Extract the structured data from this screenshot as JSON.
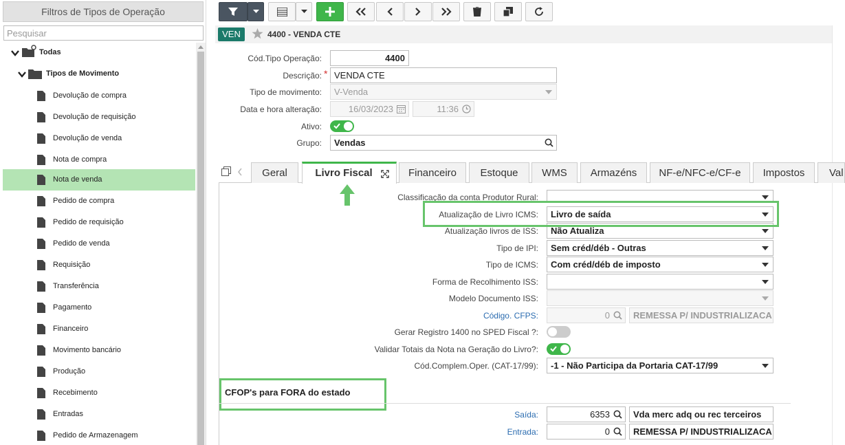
{
  "sidebar": {
    "title": "Filtros de Tipos de Operação",
    "search_placeholder": "Pesquisar",
    "tree": [
      {
        "label": "Todas",
        "level": 0
      },
      {
        "label": "Tipos de Movimento",
        "level": 1
      },
      {
        "label": "Devolução de compra",
        "level": 2
      },
      {
        "label": "Devolução de requisição",
        "level": 2
      },
      {
        "label": "Devolução de venda",
        "level": 2
      },
      {
        "label": "Nota de compra",
        "level": 2
      },
      {
        "label": "Nota de venda",
        "level": 2,
        "selected": true
      },
      {
        "label": "Pedido de compra",
        "level": 2
      },
      {
        "label": "Pedido de requisição",
        "level": 2
      },
      {
        "label": "Pedido de venda",
        "level": 2
      },
      {
        "label": "Requisição",
        "level": 2
      },
      {
        "label": "Transferência",
        "level": 2
      },
      {
        "label": "Pagamento",
        "level": 2
      },
      {
        "label": "Financeiro",
        "level": 2
      },
      {
        "label": "Movimento bancário",
        "level": 2
      },
      {
        "label": "Produção",
        "level": 2
      },
      {
        "label": "Recebimento",
        "level": 2
      },
      {
        "label": "Entradas",
        "level": 2
      },
      {
        "label": "Pedido de Armazenagem",
        "level": 2
      }
    ]
  },
  "toolbar": {
    "buttons": [
      "filter-icon",
      "dropdown-caret-icon",
      "list-icon",
      "dropdown-caret-icon",
      "plus-icon",
      "first-icon",
      "prev-icon",
      "next-icon",
      "last-icon",
      "trash-icon",
      "copy-icon",
      "refresh-icon"
    ]
  },
  "record": {
    "badge": "VEN",
    "title": "4400 - VENDA CTE"
  },
  "form": {
    "cod_label": "Cód.Tipo Operação:",
    "cod_value": "4400",
    "desc_label": "Descrição:",
    "desc_value": "VENDA CTE",
    "tipo_mov_label": "Tipo de movimento:",
    "tipo_mov_value": "V-Venda",
    "data_label": "Data e hora alteração:",
    "data_value": "16/03/2023",
    "hora_value": "11:36",
    "ativo_label": "Ativo:",
    "ativo_on": true,
    "grupo_label": "Grupo:",
    "grupo_value": "Vendas"
  },
  "tabs": [
    "Geral",
    "Livro Fiscal",
    "Financeiro",
    "Estoque",
    "WMS",
    "Armazéns",
    "NF-e/NFC-e/CF-e",
    "Impostos",
    "Val"
  ],
  "active_tab": "Livro Fiscal",
  "livro": {
    "class_label": "Classificação da conta Produtor Rural:",
    "class_value": "",
    "icms_label": "Atualização de Livro ICMS:",
    "icms_value": "Livro de saída",
    "iss_label": "Atualização livros de ISS:",
    "iss_value": "Não Atualiza",
    "ipi_label": "Tipo de IPI:",
    "ipi_value": "Sem créd/déb - Outras",
    "ticms_label": "Tipo de ICMS:",
    "ticms_value": "Com créd/déb de imposto",
    "forma_label": "Forma de Recolhimento ISS:",
    "forma_value": "",
    "modelo_label": "Modelo Documento ISS:",
    "modelo_value": "",
    "cfps_label": "Código. CFPS:",
    "cfps_num": "0",
    "cfps_desc": "REMESSA P/ INDUSTRIALIZACA",
    "gerar_label": "Gerar Registro 1400 no SPED Fiscal ?:",
    "gerar_on": false,
    "validar_label": "Validar Totais da Nota na Geração do Livro?:",
    "validar_on": true,
    "compl_label": "Cód.Complem.Oper. (CAT-17/99):",
    "compl_value": "-1 - Não Participa da Portaria CAT-17/99"
  },
  "cfop": {
    "section_title": "CFOP's para FORA do estado",
    "saida_label": "Saída:",
    "saida_num": "6353",
    "saida_desc": "Vda merc adq ou rec terceiros",
    "entrada_label": "Entrada:",
    "entrada_num": "0",
    "entrada_desc": "REMESSA P/ INDUSTRIALIZACA"
  },
  "colors": {
    "accent_green": "#3fb64a",
    "highlight_green": "#67c46b",
    "selected_row": "#b4e4b4",
    "badge_teal": "#1b7a6a",
    "link_blue": "#2b6cb0",
    "required_red": "#d32f2f"
  }
}
